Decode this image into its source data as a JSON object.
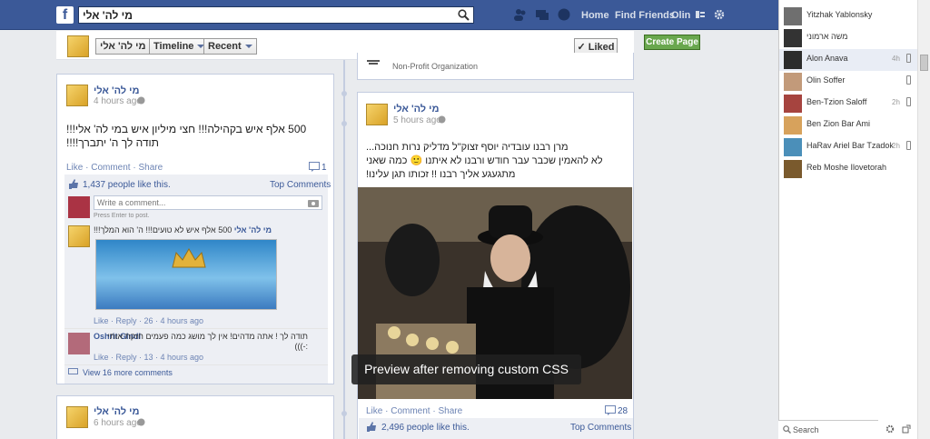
{
  "topbar": {
    "search_value": "מי לה' אלי",
    "links": [
      "Home",
      "Find Friends",
      "Olin"
    ],
    "logo": "f"
  },
  "subheader": {
    "page_pill": "מי לה' אלי",
    "timeline": "Timeline",
    "recent": "Recent",
    "liked": "Liked"
  },
  "create_page": "Create Page",
  "org_type": "Non-Profit Organization",
  "posts": [
    {
      "author": "מי לה' אלי",
      "time": "4 hours ago",
      "text": "500 אלף איש בקהילה!!! חצי מיליון איש במי לה' אלי!!! תודה לך ה' יתברך!!!!",
      "actions": "Like · Comment · Share",
      "comment_count": "1",
      "likes_text": "1,437 people like this.",
      "top_comments": "Top Comments",
      "write_comment": "Write a comment...",
      "press_enter": "Press Enter to post.",
      "reply_author": "מי לה' אלי",
      "reply_text": "500 אלף איש לא טועים!!! ה' הוא המלך!!!",
      "reply_meta": "Like · Reply · 26 · 4 hours ago",
      "comment2_author": "Oshrit Gindi",
      "comment2_text": "תודה לך ! אתה מדהים! אין לך מושג כמה פעמים חזקת אותי :-)))",
      "comment2_meta": "Like · Reply · 13 · 4 hours ago",
      "view_more": "View 16 more comments"
    },
    {
      "author": "מי לה' אלי",
      "time": "5 hours ago",
      "text_lines": [
        "מרן רבנו עובדיה יוסף זצוק\"ל מדליק נרות חנוכה...",
        "לא להאמין שכבר עבר חודש ורבנו לא איתנו 🙂 כמה שאני",
        "מתגעגע אליך רבנו !! זכותו תגן עלינו!"
      ],
      "actions": "Like · Comment · Share",
      "comment_count": "28",
      "likes_text": "2,496 people like this.",
      "top_comments": "Top Comments"
    },
    {
      "author": "מי לה' אלי",
      "time": "6 hours ago"
    }
  ],
  "overlay": "Preview after removing custom CSS",
  "chat": {
    "contacts": [
      {
        "name": "Yitzhak Yablonsky",
        "time": "",
        "mobile": false
      },
      {
        "name": "משה ארמוני",
        "time": "",
        "mobile": false
      },
      {
        "name": "Alon Anava",
        "time": "4h",
        "mobile": true
      },
      {
        "name": "Olin Soffer",
        "time": "",
        "mobile": true
      },
      {
        "name": "Ben-Tzion Saloff",
        "time": "2h",
        "mobile": true
      },
      {
        "name": "Ben Zion Bar Ami",
        "time": "",
        "mobile": false
      },
      {
        "name": "HaRav Ariel Bar Tzadok",
        "time": "2h",
        "mobile": true
      },
      {
        "name": "Reb Moshe Ilovetorah",
        "time": "",
        "mobile": false
      }
    ],
    "search_placeholder": "Search"
  }
}
